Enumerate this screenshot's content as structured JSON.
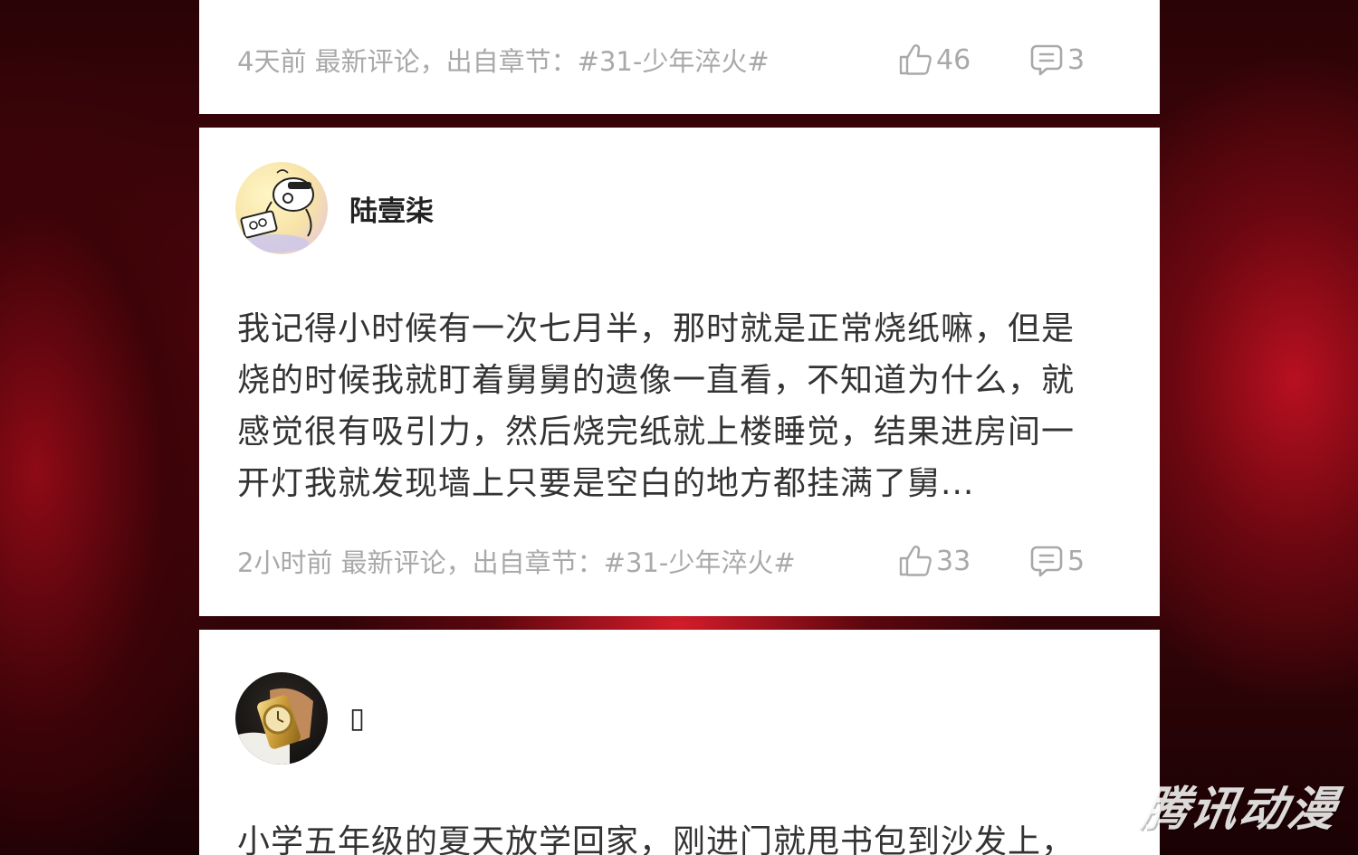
{
  "comments": [
    {
      "meta": "4天前 最新评论，出自章节：#31-少年淬火#",
      "likes": "46",
      "replies": "3"
    },
    {
      "username": "陆壹柒",
      "body": "我记得小时候有一次七月半，那时就是正常烧纸嘛，但是烧的时候我就盯着舅舅的遗像一直看，不知道为什么，就感觉很有吸引力，然后烧完纸就上楼睡觉，结果进房间一开灯我就发现墙上只要是空白的地方都挂满了舅...",
      "meta": "2小时前 最新评论，出自章节：#31-少年淬火#",
      "likes": "33",
      "replies": "5"
    },
    {
      "username": "▯",
      "body": "小学五年级的夏天放学回家，刚进门就甩书包到沙发上，"
    }
  ],
  "watermark": "腾讯动漫",
  "icons": {
    "like": "thumbs-up-icon",
    "reply": "comment-bubble-icon"
  },
  "colors": {
    "card": "#ffffff",
    "meta_text": "#a9a9a9",
    "body_text": "#333333",
    "background": "#4d060c"
  }
}
